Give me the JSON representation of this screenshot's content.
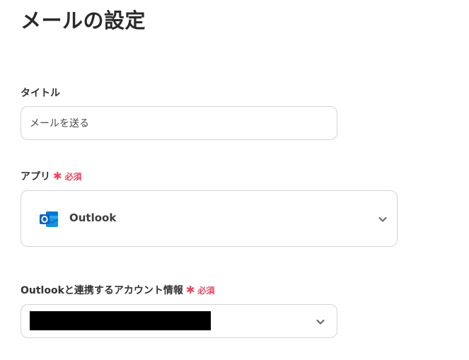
{
  "page": {
    "title": "メールの設定"
  },
  "fields": {
    "title": {
      "label": "タイトル",
      "value": "メールを送る"
    },
    "app": {
      "label": "アプリ",
      "required_label": "必須",
      "selected_app": "Outlook",
      "icon": "outlook-icon"
    },
    "account": {
      "label": "Outlookと連携するアカウント情報",
      "required_label": "必須",
      "value_redacted": true
    }
  },
  "colors": {
    "required": "#e5485e",
    "outlook_blue": "#0a64c8",
    "border": "#d4d4d4"
  }
}
